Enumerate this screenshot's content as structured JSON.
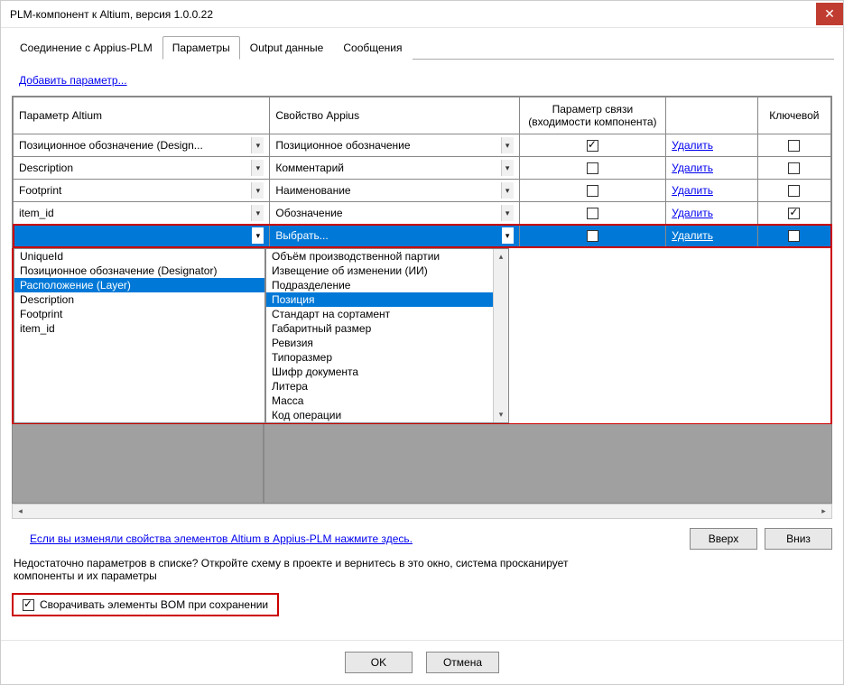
{
  "window": {
    "title": "PLM-компонент к Altium, версия 1.0.0.22"
  },
  "tabs": {
    "t0": "Соединение с Appius-PLM",
    "t1": "Параметры",
    "t2": "Output данные",
    "t3": "Сообщения",
    "active": 1
  },
  "links": {
    "add": "Добавить параметр...",
    "help": "Если вы изменяли свойства элементов Altium в Appius-PLM нажмите здесь."
  },
  "headers": {
    "altium": "Параметр Altium",
    "appius": "Свойство Appius",
    "link": "Параметр связи (входимости компонента)",
    "key": "Ключевой"
  },
  "rows": [
    {
      "altium": "Позиционное обозначение (Design...",
      "appius": "Позиционное обозначение",
      "link": true,
      "del": "Удалить",
      "key": false
    },
    {
      "altium": "Description",
      "appius": "Комментарий",
      "link": false,
      "del": "Удалить",
      "key": false
    },
    {
      "altium": "Footprint",
      "appius": "Наименование",
      "link": false,
      "del": "Удалить",
      "key": false
    },
    {
      "altium": "item_id",
      "appius": "Обозначение",
      "link": false,
      "del": "Удалить",
      "key": true
    },
    {
      "altium": "",
      "appius": "Выбрать...",
      "link": false,
      "del": "Удалить",
      "key": false
    }
  ],
  "leftList": {
    "i0": "UniqueId",
    "i1": "Позиционное обозначение (Designator)",
    "i2": "Расположение (Layer)",
    "i3": "Description",
    "i4": "Footprint",
    "i5": "item_id"
  },
  "rightList": {
    "i0": "Объём производственной партии",
    "i1": "Извещение об изменении (ИИ)",
    "i2": "Подразделение",
    "i3": "Позиция",
    "i4": "Стандарт на сортамент",
    "i5": "Габаритный размер",
    "i6": "Ревизия",
    "i7": "Типоразмер",
    "i8": "Шифр документа",
    "i9": "Литера",
    "i10": "Масса",
    "i11": "Код операции"
  },
  "buttons": {
    "up": "Вверх",
    "down": "Вниз",
    "ok": "OK",
    "cancel": "Отмена"
  },
  "footer": {
    "hint": "Недостаточно параметров в списке? Откройте схему в проекте и вернитесь в это окно, система просканирует компоненты и их параметры",
    "collapse": "Сворачивать элементы BOM при сохранении"
  }
}
